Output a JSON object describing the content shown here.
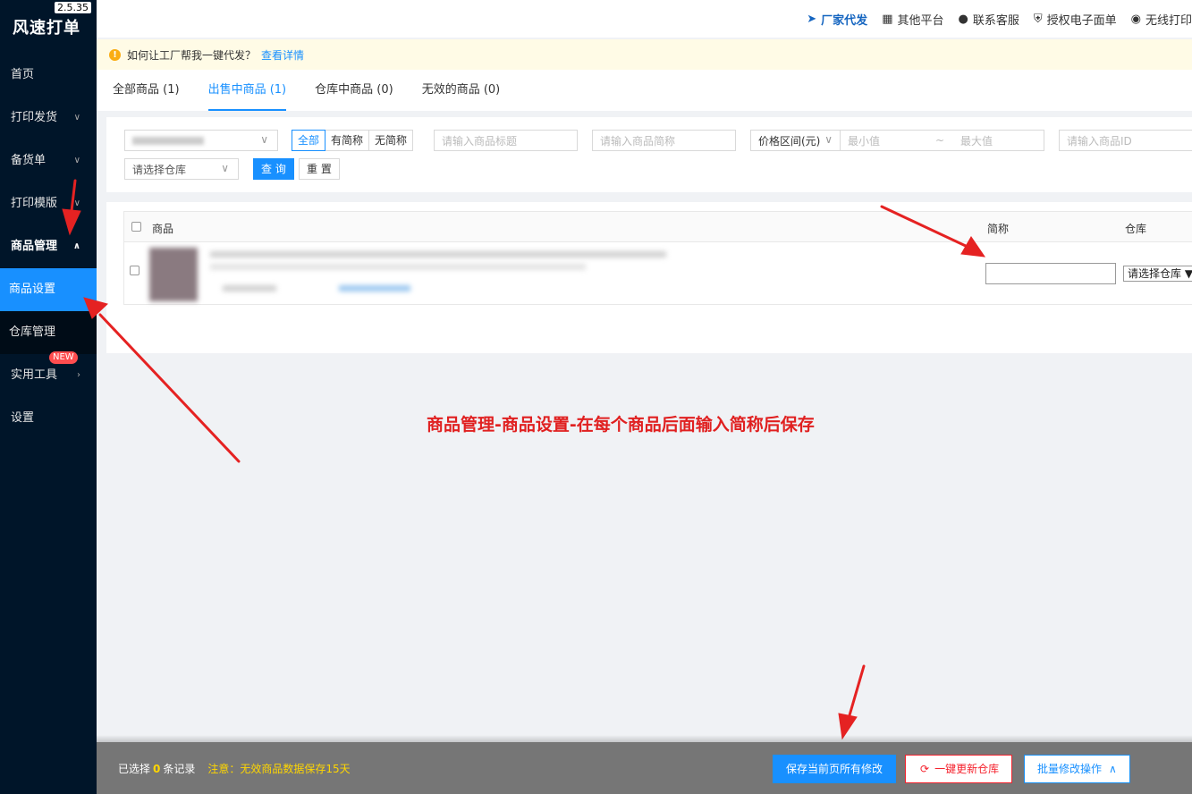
{
  "app": {
    "title": "风速打单",
    "version": "2.5.35"
  },
  "sidebar": {
    "items": [
      {
        "label": "首页"
      },
      {
        "label": "打印发货"
      },
      {
        "label": "备货单"
      },
      {
        "label": "打印模版"
      },
      {
        "label": "商品管理"
      },
      {
        "label": "商品设置"
      },
      {
        "label": "仓库管理"
      },
      {
        "label": "实用工具",
        "badge": "NEW"
      },
      {
        "label": "设置"
      }
    ]
  },
  "topbar": {
    "links": [
      {
        "label": "厂家代发",
        "icon": "send-icon"
      },
      {
        "label": "其他平台",
        "icon": "grid-icon"
      },
      {
        "label": "联系客服",
        "icon": "headset-icon"
      },
      {
        "label": "授权电子面单",
        "icon": "shield-icon"
      },
      {
        "label": "无线打印",
        "icon": "wechat-icon"
      }
    ]
  },
  "notice": {
    "text": "如何让工厂帮我一键代发？",
    "link": "查看详情"
  },
  "tabs": [
    {
      "label": "全部商品 (1)"
    },
    {
      "label": "出售中商品 (1)",
      "active": true
    },
    {
      "label": "仓库中商品 (0)"
    },
    {
      "label": "无效的商品 (0)"
    }
  ],
  "filter": {
    "segments": [
      "全部",
      "有简称",
      "无简称"
    ],
    "title_placeholder": "请输入商品标题",
    "abbr_placeholder": "请输入商品简称",
    "price_range_label": "价格区间(元)",
    "min_placeholder": "最小值",
    "range_sep": "~",
    "max_placeholder": "最大值",
    "id_placeholder": "请输入商品ID",
    "warehouse_placeholder": "请选择仓库",
    "search_label": "查 询",
    "reset_label": "重 置"
  },
  "table": {
    "headers": {
      "product": "商品",
      "abbr": "简称",
      "warehouse": "仓库"
    },
    "row": {
      "warehouse_select": "请选择仓库"
    }
  },
  "annotation": "商品管理-商品设置-在每个商品后面输入简称后保存",
  "footer": {
    "selected_prefix": "已选择",
    "selected_count": "0",
    "selected_suffix": "条记录",
    "note": "注意：无效商品数据保存15天",
    "save_label": "保存当前页所有修改",
    "update_label": "一键更新仓库",
    "batch_label": "批量修改操作"
  },
  "colors": {
    "sidebar": "#001529",
    "accent": "#1890ff",
    "annotation": "#e02020",
    "warning": "#faad14"
  }
}
